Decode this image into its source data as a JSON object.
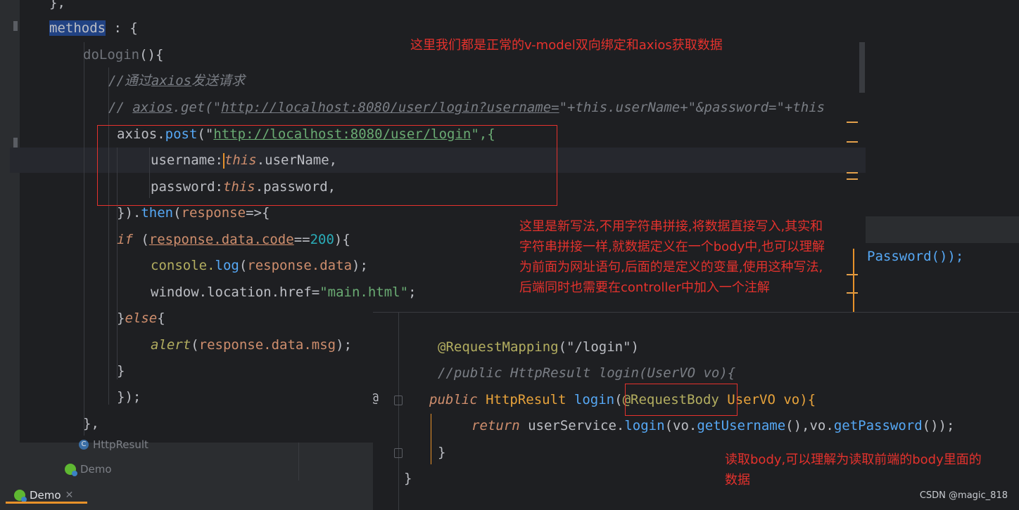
{
  "editor": {
    "code": {
      "l0": "},",
      "methods": "methods",
      "methods_rest": " : {",
      "doLogin": "doLogin",
      "doLogin_rest": "(){",
      "comment1_prefix": "//通过",
      "comment1_axios": "axios",
      "comment1_suffix": "发送请求",
      "comment2_prefix": "// ",
      "comment2_axios": "axios",
      "comment2_get": ".get(\"",
      "comment2_url": "http://localhost:8080/user/login?username=",
      "comment2_rest": "\"+this.userName+\"&password=\"+this",
      "post_axios": "axios",
      "post_dot": ".",
      "post_fn": "post",
      "post_open": "(\"",
      "post_url": "http://localhost:8080/user/login",
      "post_close": "\",{",
      "username_key": "username:",
      "this1": "this",
      "username_val": ".userName,",
      "password_key": "password:",
      "this2": "this",
      "password_val": ".password,",
      "then_close": "}).",
      "then_fn": "then",
      "then_rest_a": "(",
      "then_param": "response",
      "then_rest_b": "=>{",
      "if_kw": "if",
      "if_open": " (",
      "if_cond": "response.data.code",
      "if_eq": "==",
      "if_num": "200",
      "if_close": "){",
      "console": "console.",
      "log": "log",
      "log_open": "(",
      "log_arg": "response.data",
      "log_close": ");",
      "window": "window.location.href=",
      "window_str": "\"main.html\"",
      "window_end": ";",
      "else_open": "}",
      "else_kw": "else",
      "else_close": "{",
      "alert": "alert",
      "alert_open": "(",
      "alert_arg": "response.data.msg",
      "alert_close": ");",
      "brace1": "}",
      "brace2": "});",
      "brace3": "},"
    }
  },
  "right_code": {
    "text": "Password());"
  },
  "popup": {
    "annot": "@RequestMapping",
    "annot_arg": "(\"/login\")",
    "comment": "//public HttpResult login(UserVO vo){",
    "public_kw": "public",
    "ret_type": " HttpResult ",
    "fn": "login",
    "paren": "(",
    "req_body": "@RequestBody",
    "param": " UserVO vo){",
    "return_kw": "return",
    "return_rest_a": " userService.",
    "return_fn": "login",
    "return_rest_b": "(vo.",
    "getUsername": "getUsername",
    "return_rest_c": "(),vo.",
    "getPassword": "getPassword",
    "return_rest_d": "());",
    "brace_inner": "}",
    "brace_outer": "}",
    "at_icon": "@"
  },
  "notes": {
    "note1": "这里我们都是正常的v-model双向绑定和axios获取数据",
    "note2_l1": "这里是新写法,不用字符串拼接,将数据直接写入,其实和",
    "note2_l2": "字符串拼接一样,就数据定义在一个body中,也可以理解",
    "note2_l3": "为前面为网址语句,后面的是定义的变量,使用这种写法,",
    "note2_l4": "后端同时也需要在controller中加入一个注解",
    "note3_l1": "读取body,可以理解为读取前端的body里面的",
    "note3_l2": "数据"
  },
  "bottom": {
    "tree_item1": "HttpResult",
    "tree_item2": "Demo",
    "tab_label": "Demo",
    "tab_close": "✕"
  },
  "watermark": "CSDN @magic_818",
  "colors": {
    "annotation_red": "#e5322d",
    "editor_bg": "#1e1f22",
    "accent_orange": "#e8922a"
  }
}
